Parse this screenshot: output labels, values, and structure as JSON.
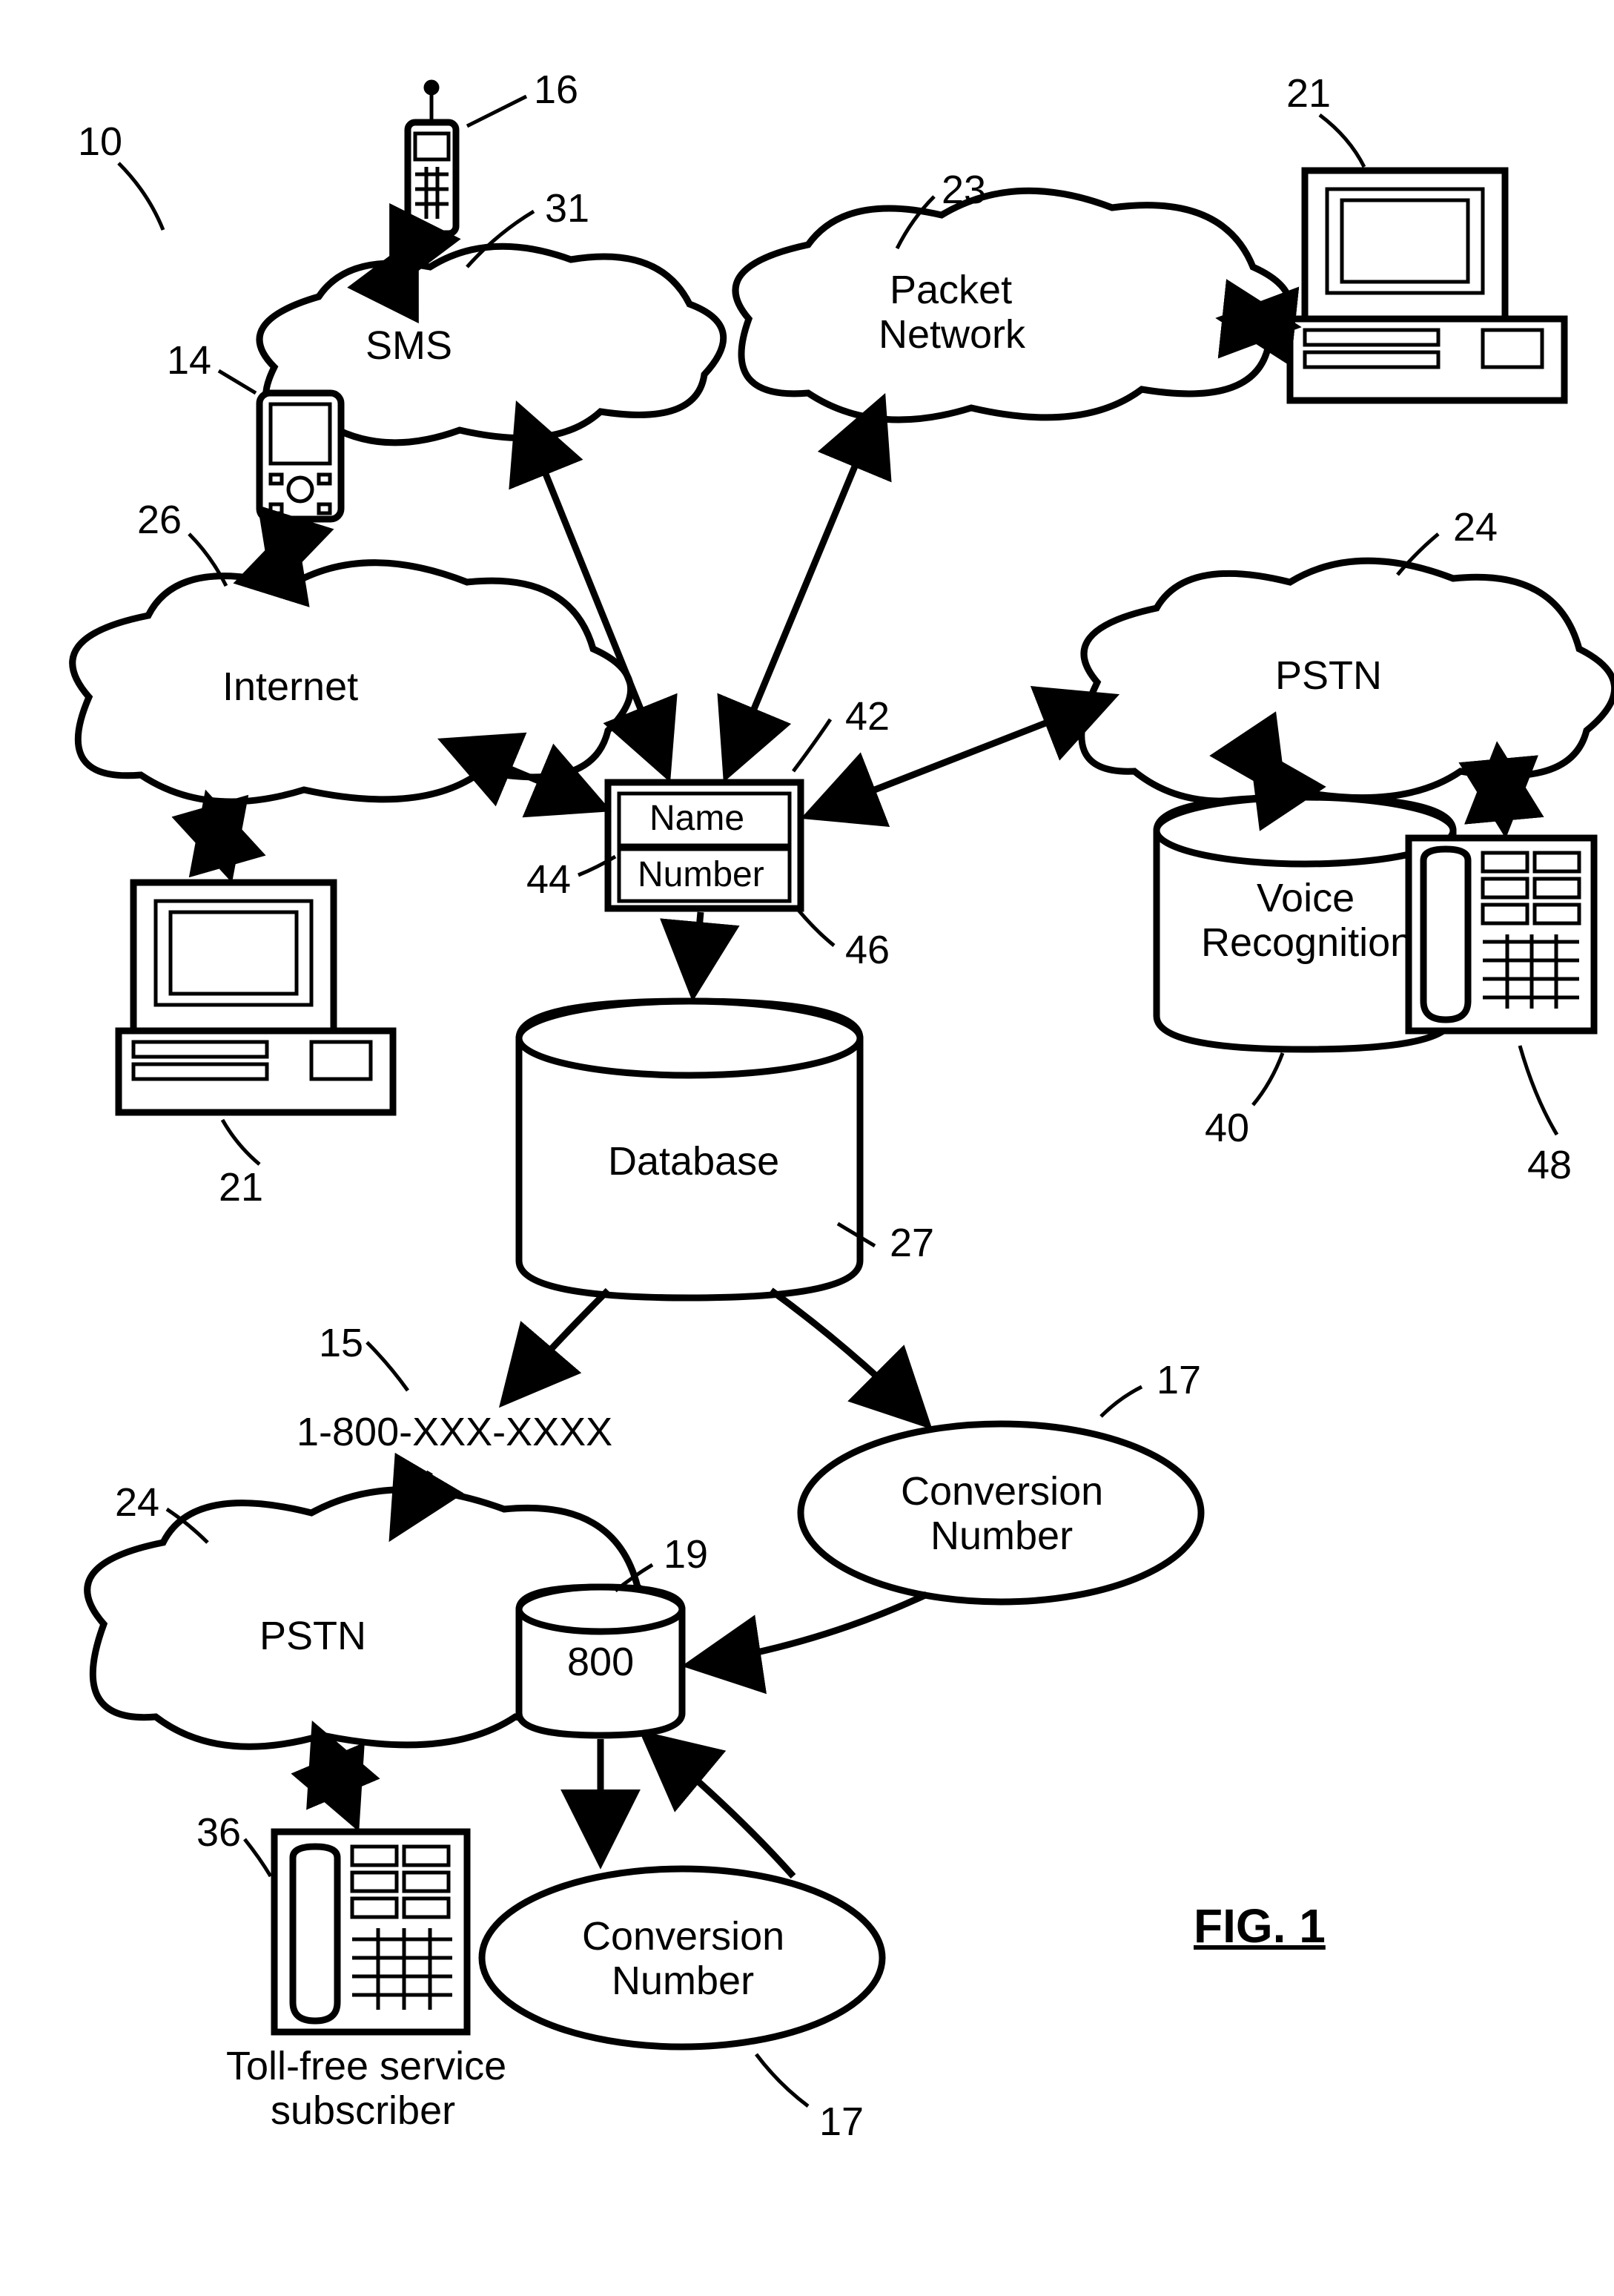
{
  "figure_caption": "FIG. 1",
  "callouts": {
    "n10": "10",
    "n16": "16",
    "n31": "31",
    "n23": "23",
    "n21a": "21",
    "n14": "14",
    "n26": "26",
    "n24a": "24",
    "n42": "42",
    "n44": "44",
    "n46": "46",
    "n40": "40",
    "n48": "48",
    "n21b": "21",
    "n27": "27",
    "n15": "15",
    "n17a": "17",
    "n24b": "24",
    "n19": "19",
    "n36": "36",
    "n17b": "17"
  },
  "nodes": {
    "sms": "SMS",
    "packet_network_l1": "Packet",
    "packet_network_l2": "Network",
    "internet": "Internet",
    "pstn1": "PSTN",
    "pstn2": "PSTN",
    "name": "Name",
    "number": "Number",
    "voice_rec_l1": "Voice",
    "voice_rec_l2": "Recognition",
    "database": "Database",
    "phone800": "1-800-XXX-XXXX",
    "db800": "800",
    "conv1_l1": "Conversion",
    "conv1_l2": "Number",
    "conv2_l1": "Conversion",
    "conv2_l2": "Number",
    "tollfree_l1": "Toll-free service",
    "tollfree_l2": "subscriber"
  }
}
